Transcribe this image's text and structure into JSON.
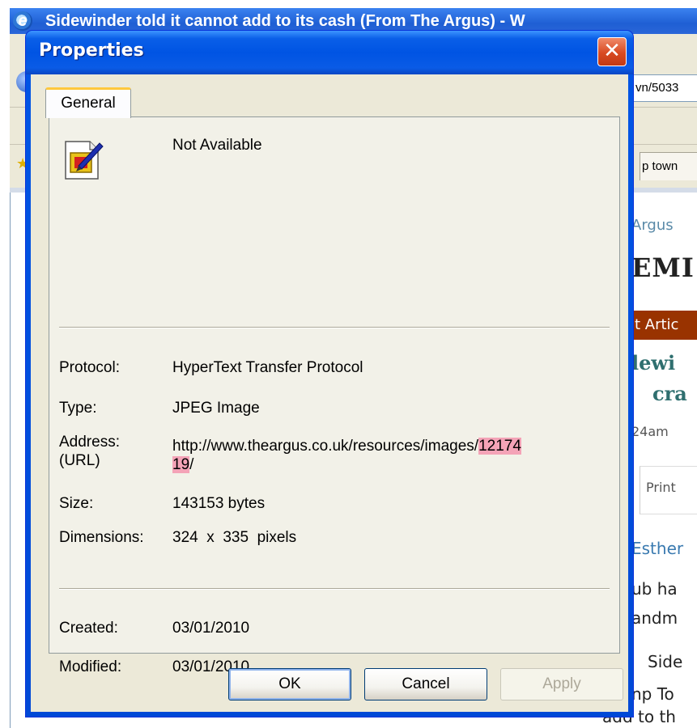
{
  "background_window": {
    "title": "Sidewinder told it cannot add to its cash (From The Argus) - W",
    "address_fragment": "vn/5033",
    "favorites_tab_text": "p town",
    "page_lines": {
      "argus": "Argus",
      "emb": "EMI",
      "article_bar": "t Artic",
      "headline1": "lewi",
      "headline2": "cra",
      "time": "24am",
      "print": "Print",
      "author": "Esther",
      "body1": "ub ha",
      "body2": "andm",
      "body3": "Side",
      "body4": "np To",
      "body5": "add to th"
    }
  },
  "dialog": {
    "title": "Properties",
    "close_label": "✕",
    "tab_label": "General",
    "name_value": "Not Available",
    "fields": {
      "protocol_label": "Protocol:",
      "protocol_value": "HyperText Transfer Protocol",
      "type_label": "Type:",
      "type_value": "JPEG Image",
      "address_label_line1": "Address:",
      "address_label_line2": "(URL)",
      "address_value_plain": "http://www.theargus.co.uk/resources/images/",
      "address_value_highlight1": "12174",
      "address_value_highlight2": "19",
      "address_value_tail": "/",
      "size_label": "Size:",
      "size_value": "143153 bytes",
      "dimensions_label": "Dimensions:",
      "dimensions_value": "324  x  335  pixels",
      "created_label": "Created:",
      "created_value": "03/01/2010",
      "modified_label": "Modified:",
      "modified_value": "03/01/2010"
    },
    "buttons": {
      "ok": "OK",
      "cancel": "Cancel",
      "apply": "Apply"
    }
  },
  "colors": {
    "title_blue": "#0054e3",
    "dialog_bg": "#ece9d8",
    "url_highlight": "#f4a3b7",
    "close_red": "#d84a22"
  },
  "icons": {
    "file_icon": "image-file-icon",
    "browser_icon": "ie-icon",
    "close_icon": "close-icon"
  }
}
